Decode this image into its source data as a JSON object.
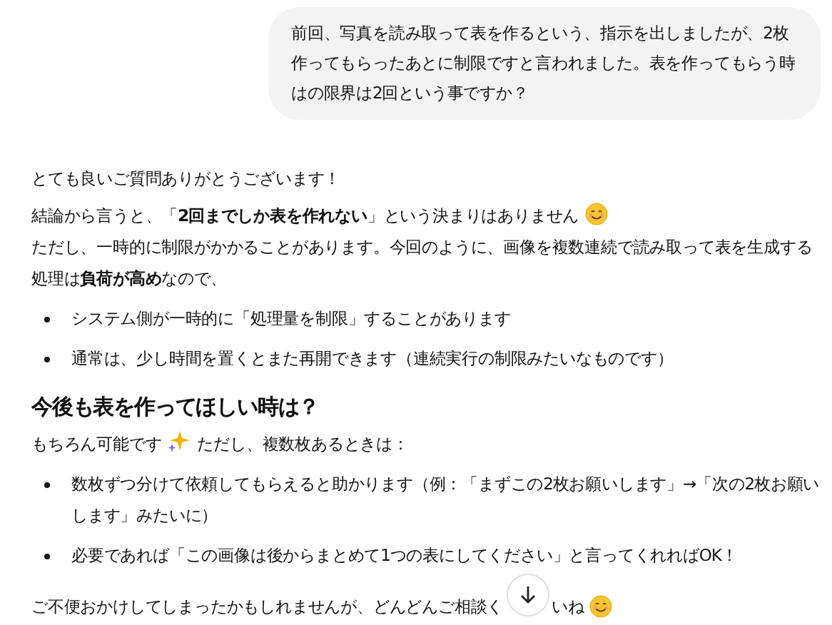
{
  "user_message": "前回、写真を読み取って表を作るという、指示を出しましたが、2枚作ってもらったあとに制限ですと言われました。表を作ってもらう時はの限界は2回という事ですか？",
  "reply": {
    "greeting": "とても良いご質問ありがとうございます！",
    "conclusion": "結論から言うと、「**2回までしか表を作れない**」という決まりはありません",
    "explanation": "ただし、一時的に制限がかかることがあります。今回のように、画像を複数連続で読み取って表を生成する処理は**負荷が高め**なので、",
    "bullets_1": [
      "システム側が一時的に「処理量を制限」することがあります",
      "通常は、少し時間を置くとまた再開できます（連続実行の制限みたいなものです）"
    ],
    "heading": "今後も表を作ってほしい時は？",
    "intro": "もちろん可能です",
    "intro_rest": "ただし、複数枚あるときは：",
    "bullets_2": [
      "数枚ずつ分けて依頼してもらえると助かります（例：「まずこの2枚お願いします」→「次の2枚お願いします」みたいに）",
      "必要であれば「この画像は後からまとめて1つの表にしてください」と言ってくれればOK！"
    ],
    "closing": "ご不便おかけしてしまったかもしれませんが、どんどんご相談く",
    "closing_end": "いね"
  }
}
